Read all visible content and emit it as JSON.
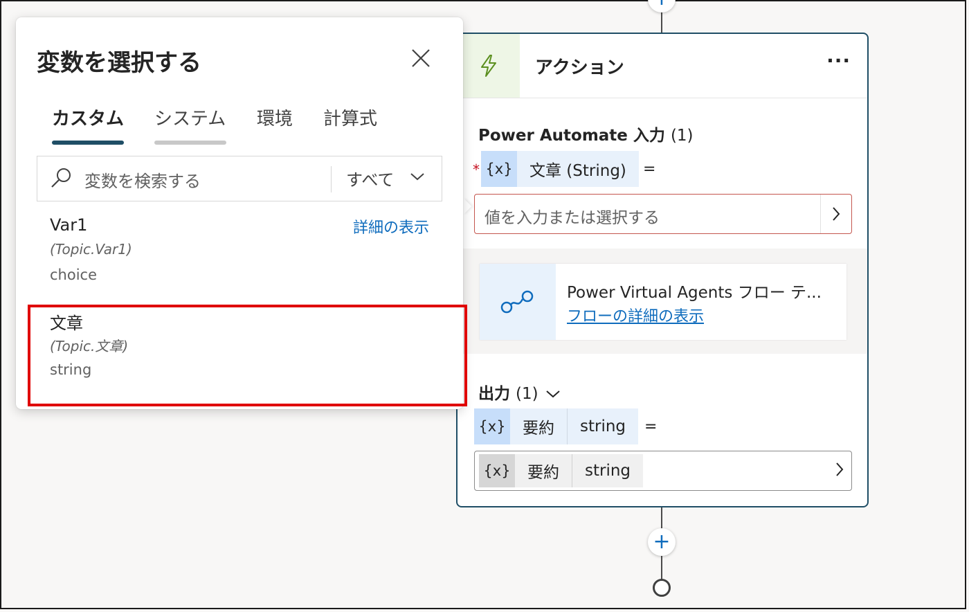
{
  "flyout": {
    "title": "変数を選択する",
    "tabs": [
      {
        "label": "カスタム",
        "active": true
      },
      {
        "label": "システム",
        "active": false
      },
      {
        "label": "環境",
        "active": false
      },
      {
        "label": "計算式",
        "active": false
      }
    ],
    "search": {
      "placeholder": "変数を検索する",
      "filter_value": "すべて"
    },
    "variables": [
      {
        "name": "Var1",
        "scope": "(Topic.Var1)",
        "type": "choice",
        "detail_link": "詳細の表示"
      },
      {
        "name": "文章",
        "scope": "(Topic.文章)",
        "type": "string"
      }
    ]
  },
  "action_card": {
    "title": "アクション",
    "more_label": "···",
    "input_section": {
      "title": "Power Automate 入力",
      "count": "(1)",
      "required_mark": "*",
      "var_token": "{x}",
      "param_label": "文章 (String)",
      "equals": "=",
      "value_placeholder": "値を入力または選択する"
    },
    "flow": {
      "name": "Power Virtual Agents フロー テ...",
      "details_link": "フローの詳細の表示"
    },
    "output_section": {
      "title": "出力",
      "count": "(1)",
      "var_token": "{x}",
      "param_name": "要約",
      "param_type": "string",
      "equals": "=",
      "value_token": "{x}",
      "value_name": "要約",
      "value_type": "string"
    }
  },
  "colors": {
    "accent": "#0f6cbd",
    "card_border": "#1f4e66",
    "tab_active_underline": "#1f4e66",
    "highlight": "#e00000"
  }
}
